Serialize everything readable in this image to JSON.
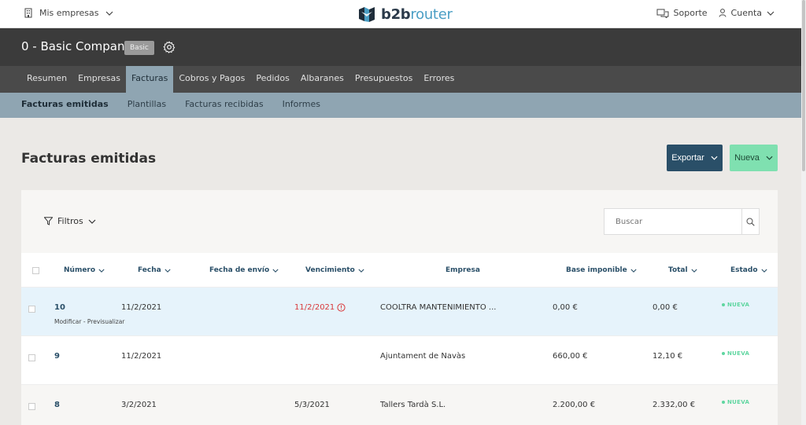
{
  "topbar": {
    "my_companies": "Mis empresas",
    "logo_b2b": "b2b",
    "logo_router": "router",
    "support": "Soporte",
    "account": "Cuenta"
  },
  "company": {
    "name": "0 - Basic Company",
    "plan_badge": "Basic"
  },
  "main_nav": [
    {
      "label": "Resumen",
      "active": false
    },
    {
      "label": "Empresas",
      "active": false
    },
    {
      "label": "Facturas",
      "active": true
    },
    {
      "label": "Cobros y Pagos",
      "active": false
    },
    {
      "label": "Pedidos",
      "active": false
    },
    {
      "label": "Albaranes",
      "active": false
    },
    {
      "label": "Presupuestos",
      "active": false
    },
    {
      "label": "Errores",
      "active": false
    }
  ],
  "sub_nav": [
    {
      "label": "Facturas emitidas",
      "active": true
    },
    {
      "label": "Plantillas",
      "active": false
    },
    {
      "label": "Facturas recibidas",
      "active": false
    },
    {
      "label": "Informes",
      "active": false
    }
  ],
  "page": {
    "title": "Facturas emitidas",
    "export_label": "Exportar",
    "new_label": "Nueva"
  },
  "filters": {
    "label": "Filtros",
    "search_placeholder": "Buscar"
  },
  "table": {
    "columns": {
      "numero": "Número",
      "fecha": "Fecha",
      "fecha_envio": "Fecha de envío",
      "vencimiento": "Vencimiento",
      "empresa": "Empresa",
      "base": "Base imponible",
      "total": "Total",
      "estado": "Estado"
    },
    "rows": [
      {
        "numero": "10",
        "fecha": "11/2/2021",
        "vencimiento": "11/2/2021",
        "empresa": "COOLTRA MANTENIMIENTO ...",
        "base": "0,00 €",
        "total": "0,00 €",
        "estado": "NUEVA",
        "actions": "Modificar - Previsualizar"
      },
      {
        "numero": "9",
        "fecha": "11/2/2021",
        "vencimiento": "",
        "empresa": "Ajuntament de Navàs",
        "base": "660,00 €",
        "total": "12,10 €",
        "estado": "NUEVA"
      },
      {
        "numero": "8",
        "fecha": "3/2/2021",
        "vencimiento": "5/3/2021",
        "empresa": "Tallers Tardà S.L.",
        "base": "2.200,00 €",
        "total": "2.332,00 €",
        "estado": "NUEVA"
      }
    ]
  },
  "colors": {
    "dark_bar": "#3b3b3b",
    "nav_bar": "#4a4a4a",
    "sub_bar": "#8fa5b2",
    "export_btn": "#2a4f68",
    "new_btn": "#7fe0b0",
    "status_green": "#5fd6a0",
    "overdue_red": "#d9383a"
  }
}
